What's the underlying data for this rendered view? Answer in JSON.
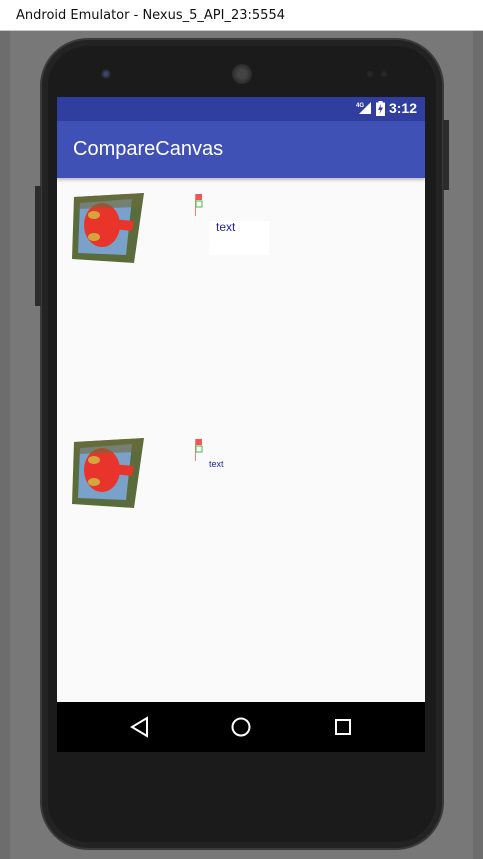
{
  "window": {
    "title": "Android Emulator - Nexus_5_API_23:5554"
  },
  "statusbar": {
    "time": "3:12",
    "network": "4G"
  },
  "appbar": {
    "title": "CompareCanvas"
  },
  "canvas_rows": [
    {
      "label": "text"
    },
    {
      "label": "text"
    }
  ],
  "navbar": {
    "back": "back-icon",
    "home": "home-icon",
    "recents": "recents-icon"
  },
  "colors": {
    "status": "#303f9f",
    "primary": "#3f51b5",
    "text": "#1f1fb3"
  }
}
